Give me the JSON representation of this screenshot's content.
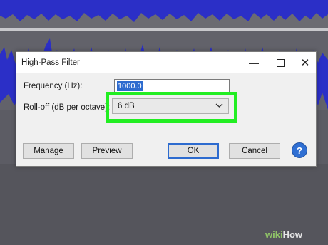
{
  "dialog": {
    "title": "High-Pass Filter",
    "window_buttons": {
      "minimize": "—",
      "close": "✕"
    },
    "frequency": {
      "label": "Frequency (Hz):",
      "value": "1000.0"
    },
    "rolloff": {
      "label": "Roll-off (dB per octave):",
      "selected": "6 dB"
    },
    "buttons": {
      "manage": "Manage",
      "preview": "Preview",
      "ok": "OK",
      "cancel": "Cancel",
      "help": "?"
    }
  },
  "watermark": {
    "prefix": "wiki",
    "suffix": "How"
  },
  "colors": {
    "waveform": "#2b2fc7",
    "highlight": "#22ee22",
    "accent": "#2d6bcf"
  }
}
